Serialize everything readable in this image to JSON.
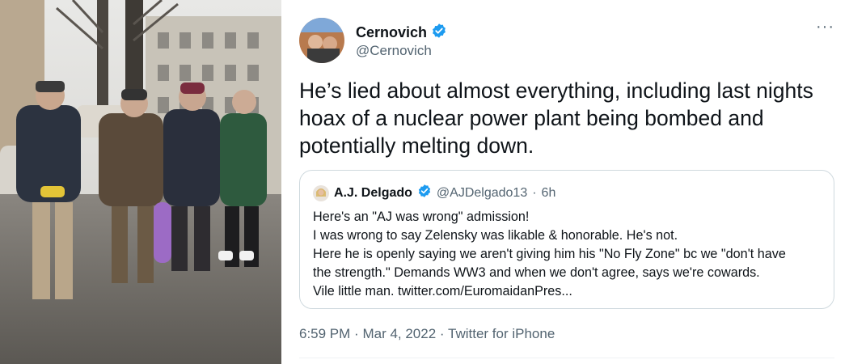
{
  "photo": {
    "description_icon": "soldiers-street-photo"
  },
  "author": {
    "name": "Cernovich",
    "handle": "@Cernovich",
    "verified_icon": "verified-badge-icon"
  },
  "more_label": "···",
  "tweet": {
    "text": "He’s lied about almost everything, including last nights hoax of a nuclear power plant being bombed and potentially melting down."
  },
  "quote": {
    "name": "A.J. Delgado",
    "handle": "@AJDelgado13",
    "dot": "·",
    "time": "6h",
    "lines": [
      "Here's an \"AJ was wrong\" admission!",
      "I was wrong to say Zelensky was likable & honorable. He's not.",
      "Here he is openly saying we aren't giving him his \"No Fly Zone\" bc we \"don't have",
      "the strength.\" Demands WW3 and when we don't agree, says we're cowards.",
      "Vile little man. twitter.com/EuromaidanPres..."
    ]
  },
  "meta": {
    "time": "6:59 PM",
    "date": "Mar 4, 2022",
    "client": "Twitter for iPhone",
    "separator": "·"
  },
  "colors": {
    "accent": "#1d9bf0",
    "text": "#0f1419",
    "secondary": "#536471",
    "border": "#cfd9de"
  }
}
